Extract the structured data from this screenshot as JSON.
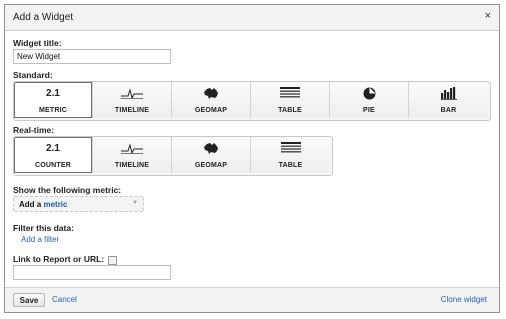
{
  "dialog": {
    "title": "Add a Widget",
    "close_glyph": "×"
  },
  "widget_title": {
    "label": "Widget title:",
    "value": "New Widget"
  },
  "standard": {
    "label": "Standard:",
    "buttons": [
      {
        "icon_text": "2.1",
        "caption": "METRIC",
        "selected": true
      },
      {
        "icon": "timeline-icon",
        "caption": "TIMELINE"
      },
      {
        "icon": "geomap-icon",
        "caption": "GEOMAP"
      },
      {
        "icon": "table-icon",
        "caption": "TABLE"
      },
      {
        "icon": "pie-icon",
        "caption": "PIE"
      },
      {
        "icon": "bar-icon",
        "caption": "BAR"
      }
    ]
  },
  "realtime": {
    "label": "Real-time:",
    "buttons": [
      {
        "icon_text": "2.1",
        "caption": "COUNTER",
        "selected": true
      },
      {
        "icon": "timeline-icon",
        "caption": "TIMELINE"
      },
      {
        "icon": "geomap-icon",
        "caption": "GEOMAP"
      },
      {
        "icon": "table-icon",
        "caption": "TABLE"
      }
    ]
  },
  "metric": {
    "label": "Show the following metric:",
    "dropdown_prefix": "Add a",
    "dropdown_link": "metric"
  },
  "filter": {
    "label": "Filter this data:",
    "link": "Add a filter"
  },
  "link_report": {
    "label": "Link to Report or URL:",
    "value": ""
  },
  "footer": {
    "save": "Save",
    "cancel": "Cancel",
    "clone": "Clone widget"
  }
}
